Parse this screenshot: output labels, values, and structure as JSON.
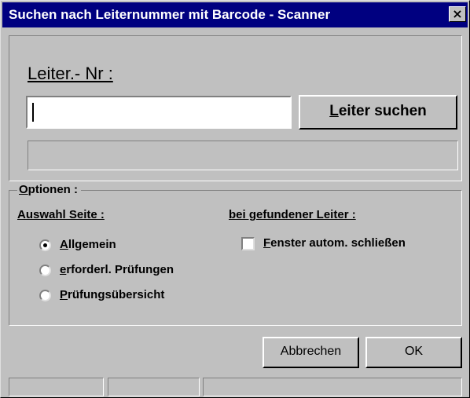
{
  "window": {
    "title": "Suchen nach Leiternummer mit Barcode - Scanner",
    "close_glyph": "×"
  },
  "search": {
    "label": "Leiter.- Nr :",
    "input_value": "",
    "button_label_first": "L",
    "button_label_rest": "eiter suchen",
    "status_text": ""
  },
  "options": {
    "legend_first": "O",
    "legend_rest": "ptionen :",
    "auswahl_label": "Auswahl Seite :",
    "radios": [
      {
        "first": "A",
        "rest": "llgemein",
        "checked": true
      },
      {
        "first": "e",
        "rest": "rforderl. Prüfungen",
        "checked": false
      },
      {
        "first": "P",
        "rest": "rüfungsübersicht",
        "checked": false
      }
    ],
    "found_label": "bei gefundener Leiter :",
    "checkbox": {
      "first": "F",
      "rest": "enster autom. schließen",
      "checked": false
    }
  },
  "buttons": {
    "cancel": "Abbrechen",
    "ok": "OK"
  },
  "statusbar": {
    "panes": [
      "",
      "",
      ""
    ]
  }
}
